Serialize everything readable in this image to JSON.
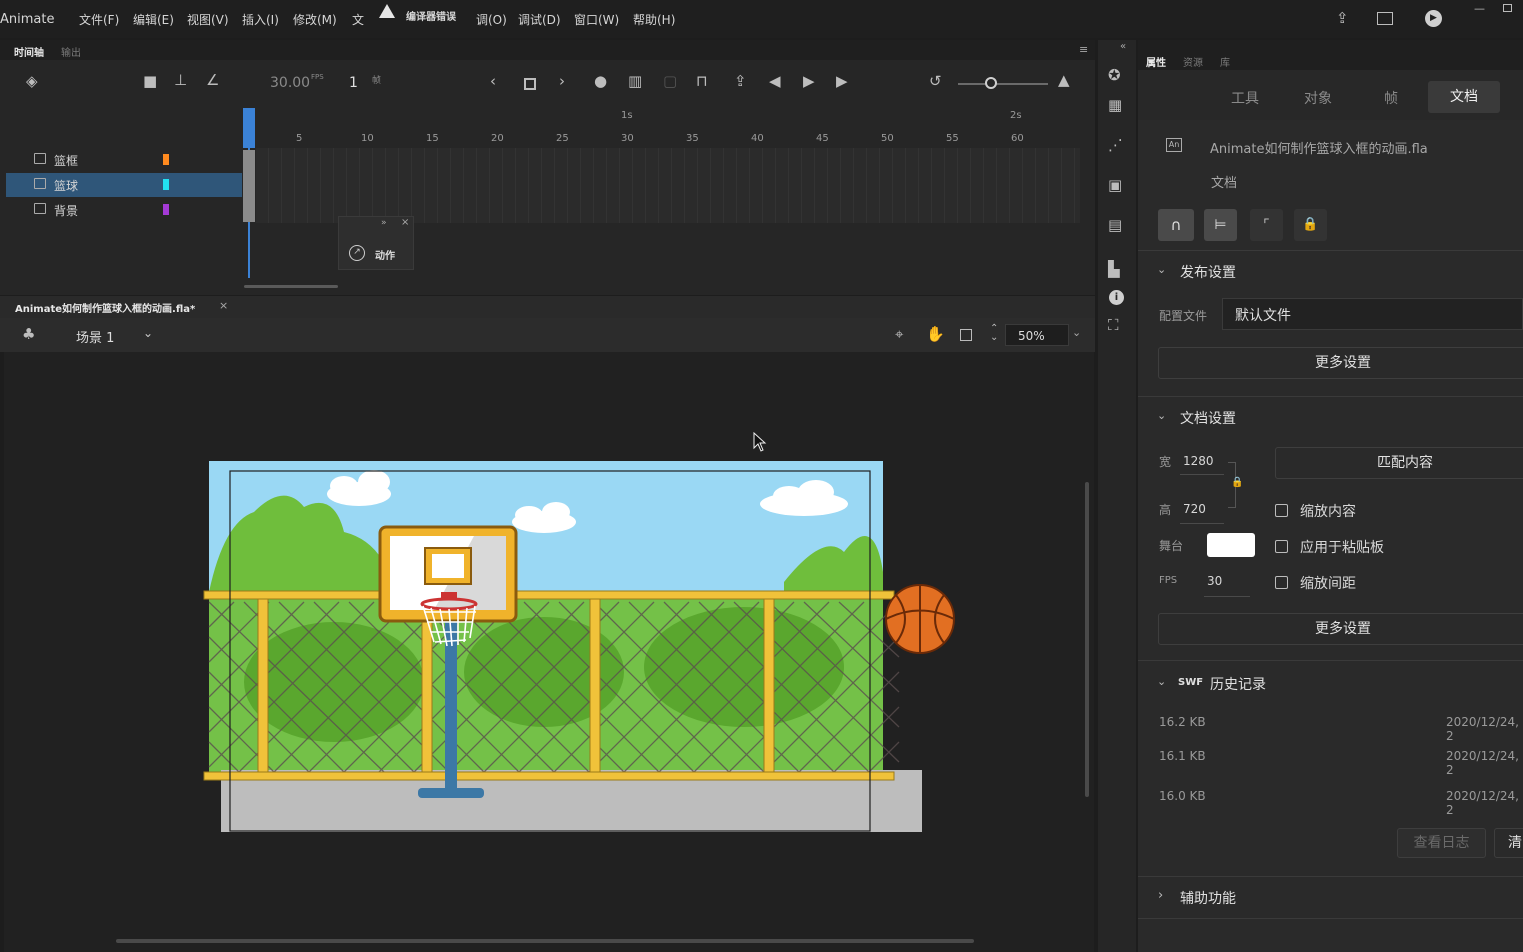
{
  "app": {
    "name": "Animate"
  },
  "menu": [
    "文件(F)",
    "编辑(E)",
    "视图(V)",
    "插入(I)",
    "修改(M)",
    "文",
    "调(O)",
    "调试(D)",
    "窗口(W)",
    "帮助(H)"
  ],
  "compiler_warning": "编译器错误",
  "timeline": {
    "tabs": [
      "时间轴",
      "输出"
    ],
    "fps": "30.00",
    "fps_unit": "FPS",
    "frame": "1",
    "frame_unit": "帧",
    "ruler_seconds": [
      "1s",
      "2s"
    ],
    "ruler_ticks": [
      "5",
      "10",
      "15",
      "20",
      "25",
      "30",
      "35",
      "40",
      "45",
      "50",
      "55",
      "60"
    ],
    "layers": [
      {
        "name": "篮框",
        "color": "#ff8a1f",
        "selected": false
      },
      {
        "name": "篮球",
        "color": "#22e0f0",
        "selected": true
      },
      {
        "name": "背景",
        "color": "#a43ad6",
        "selected": false
      }
    ],
    "action_panel_label": "动作"
  },
  "document": {
    "tab_title": "Animate如何制作篮球入框的动画.fla*",
    "scene": "场景 1",
    "zoom": "50%"
  },
  "properties": {
    "top_tabs": [
      "属性",
      "资源",
      "库"
    ],
    "sub_tabs": [
      "工具",
      "对象",
      "帧",
      "文档"
    ],
    "active_sub_tab": "文档",
    "file_name": "Animate如何制作篮球入框的动画.fla",
    "file_type": "文档",
    "publish": {
      "title": "发布设置",
      "profile_label": "配置文件",
      "profile_value": "默认文件",
      "more_button": "更多设置"
    },
    "doc_settings": {
      "title": "文档设置",
      "width_label": "宽",
      "width": "1280",
      "height_label": "高",
      "height": "720",
      "stage_label": "舞台",
      "stage_color": "#ffffff",
      "fps_label": "FPS",
      "fps": "30",
      "match_button": "匹配内容",
      "checkboxes": [
        "缩放内容",
        "应用于粘贴板",
        "缩放间距"
      ],
      "more_button": "更多设置"
    },
    "swf_history": {
      "title_prefix": "SWF",
      "title": "历史记录",
      "rows": [
        {
          "size": "16.2 KB",
          "date": "2020/12/24, 2"
        },
        {
          "size": "16.1 KB",
          "date": "2020/12/24, 2"
        },
        {
          "size": "16.0 KB",
          "date": "2020/12/24, 2"
        }
      ],
      "log_button": "查看日志",
      "clear_button": "清"
    },
    "accessibility": {
      "title": "辅助功能"
    }
  }
}
